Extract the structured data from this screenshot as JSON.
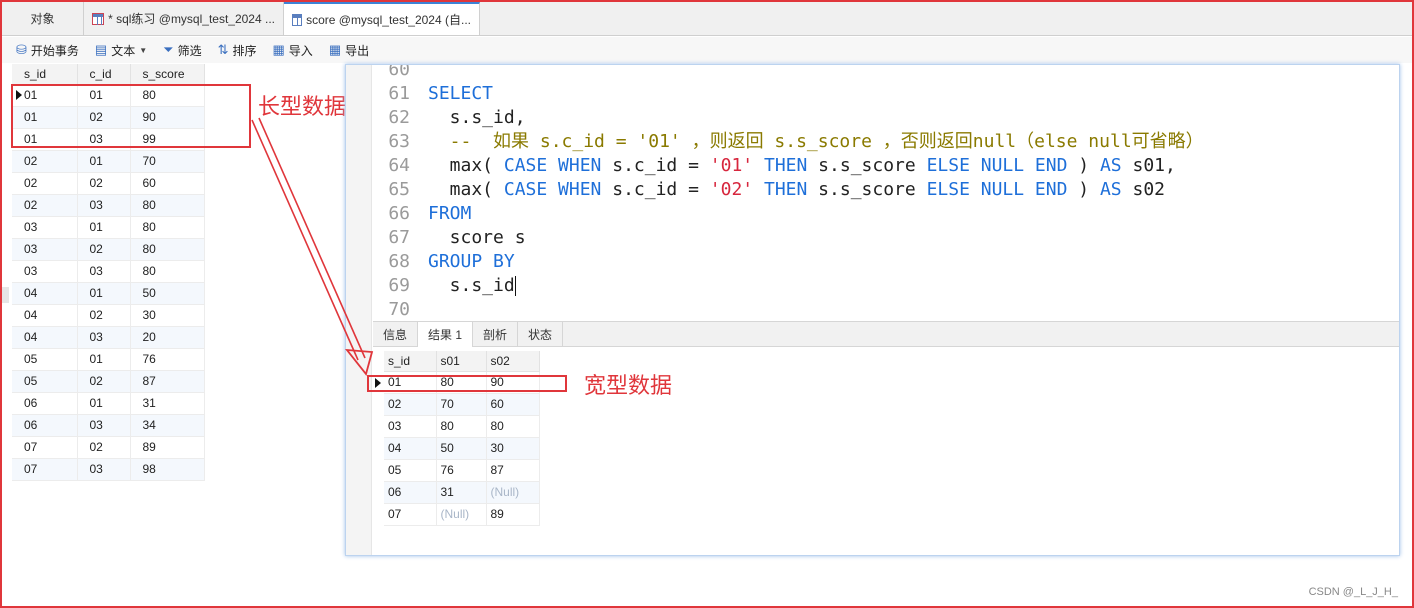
{
  "tabs": [
    {
      "label": "对象"
    },
    {
      "label": "* sql练习 @mysql_test_2024 ..."
    },
    {
      "label": "score @mysql_test_2024 (自..."
    }
  ],
  "toolbar": {
    "begin_tx": "开始事务",
    "text": "文本",
    "filter": "筛选",
    "sort": "排序",
    "import": "导入",
    "export": "导出"
  },
  "left_grid": {
    "headers": [
      "s_id",
      "c_id",
      "s_score"
    ],
    "rows": [
      [
        "01",
        "01",
        "80"
      ],
      [
        "01",
        "02",
        "90"
      ],
      [
        "01",
        "03",
        "99"
      ],
      [
        "02",
        "01",
        "70"
      ],
      [
        "02",
        "02",
        "60"
      ],
      [
        "02",
        "03",
        "80"
      ],
      [
        "03",
        "01",
        "80"
      ],
      [
        "03",
        "02",
        "80"
      ],
      [
        "03",
        "03",
        "80"
      ],
      [
        "04",
        "01",
        "50"
      ],
      [
        "04",
        "02",
        "30"
      ],
      [
        "04",
        "03",
        "20"
      ],
      [
        "05",
        "01",
        "76"
      ],
      [
        "05",
        "02",
        "87"
      ],
      [
        "06",
        "01",
        "31"
      ],
      [
        "06",
        "03",
        "34"
      ],
      [
        "07",
        "02",
        "89"
      ],
      [
        "07",
        "03",
        "98"
      ]
    ]
  },
  "annotations": {
    "long": "长型数据",
    "wide": "宽型数据"
  },
  "editor": {
    "lines": [
      {
        "n": "60",
        "parts": []
      },
      {
        "n": "61",
        "parts": [
          {
            "t": "SELECT",
            "c": "kw"
          }
        ]
      },
      {
        "n": "62",
        "parts": [
          {
            "t": "  s.s_id,",
            "c": "txt"
          }
        ]
      },
      {
        "n": "63",
        "parts": [
          {
            "t": "  --  如果 s.c_id = '01' ，则返回 s.s_score ，否则返回null（else null可省略）",
            "c": "cm"
          }
        ]
      },
      {
        "n": "64",
        "parts": [
          {
            "t": "  max( ",
            "c": "txt"
          },
          {
            "t": "CASE WHEN",
            "c": "kw"
          },
          {
            "t": " s.c_id = ",
            "c": "txt"
          },
          {
            "t": "'01'",
            "c": "str"
          },
          {
            "t": " ",
            "c": "txt"
          },
          {
            "t": "THEN",
            "c": "kw"
          },
          {
            "t": " s.s_score ",
            "c": "txt"
          },
          {
            "t": "ELSE NULL END",
            "c": "kw"
          },
          {
            "t": " ) ",
            "c": "txt"
          },
          {
            "t": "AS",
            "c": "kw"
          },
          {
            "t": " s01,",
            "c": "txt"
          }
        ]
      },
      {
        "n": "65",
        "parts": [
          {
            "t": "  max( ",
            "c": "txt"
          },
          {
            "t": "CASE WHEN",
            "c": "kw"
          },
          {
            "t": " s.c_id = ",
            "c": "txt"
          },
          {
            "t": "'02'",
            "c": "str"
          },
          {
            "t": " ",
            "c": "txt"
          },
          {
            "t": "THEN",
            "c": "kw"
          },
          {
            "t": " s.s_score ",
            "c": "txt"
          },
          {
            "t": "ELSE NULL END",
            "c": "kw"
          },
          {
            "t": " ) ",
            "c": "txt"
          },
          {
            "t": "AS",
            "c": "kw"
          },
          {
            "t": " s02",
            "c": "txt"
          }
        ]
      },
      {
        "n": "66",
        "parts": [
          {
            "t": "FROM",
            "c": "kw"
          }
        ]
      },
      {
        "n": "67",
        "parts": [
          {
            "t": "  score s",
            "c": "txt"
          }
        ]
      },
      {
        "n": "68",
        "parts": [
          {
            "t": "GROUP BY",
            "c": "kw"
          }
        ]
      },
      {
        "n": "69",
        "parts": [
          {
            "t": "  s.s_id",
            "c": "txt"
          }
        ]
      },
      {
        "n": "70",
        "parts": []
      }
    ]
  },
  "result_tabs": [
    "信息",
    "结果 1",
    "剖析",
    "状态"
  ],
  "right_grid": {
    "headers": [
      "s_id",
      "s01",
      "s02"
    ],
    "rows": [
      [
        "01",
        "80",
        "90"
      ],
      [
        "02",
        "70",
        "60"
      ],
      [
        "03",
        "80",
        "80"
      ],
      [
        "04",
        "50",
        "30"
      ],
      [
        "05",
        "76",
        "87"
      ],
      [
        "06",
        "31",
        "(Null)"
      ],
      [
        "07",
        "(Null)",
        "89"
      ]
    ]
  },
  "watermark": "CSDN @_L_J_H_",
  "colors": {
    "annotation": "#e0363b",
    "keyword": "#1e6fd9",
    "string": "#d7263d",
    "comment": "#8a7a00"
  }
}
